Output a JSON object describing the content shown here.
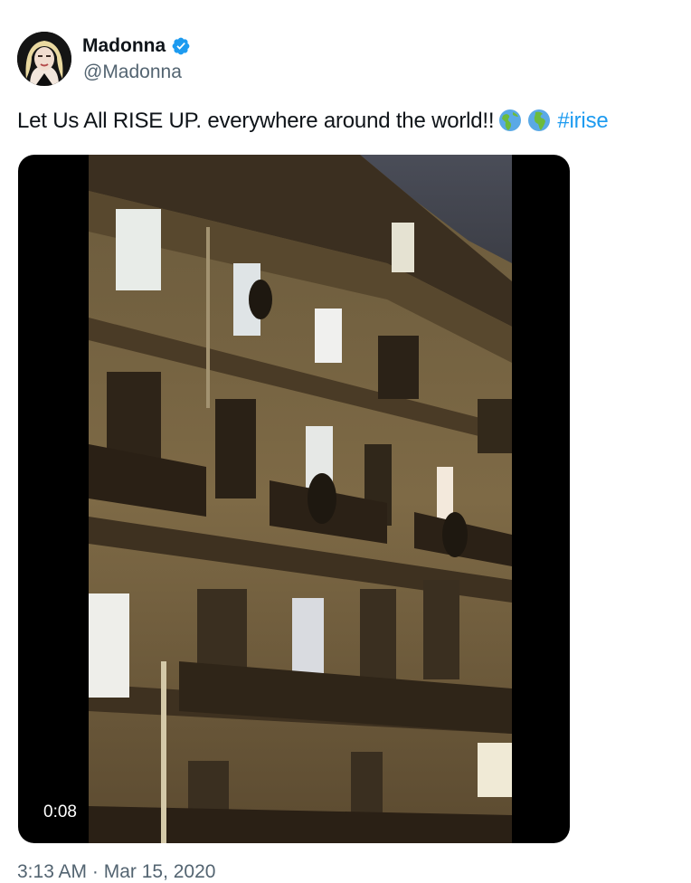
{
  "author": {
    "display_name": "Madonna",
    "handle": "@Madonna",
    "verified": true,
    "verified_color": "#1d9bf0"
  },
  "tweet": {
    "text": "Let Us All RISE UP. everywhere around the world!!",
    "emoji": [
      "globe-americas-icon",
      "globe-europe-africa-icon"
    ],
    "hashtag": "#irise",
    "hashtag_color": "#1d9bf0"
  },
  "media": {
    "type": "video",
    "duration": "0:08"
  },
  "meta": {
    "timestamp": "3:13 AM · Mar 15, 2020"
  }
}
